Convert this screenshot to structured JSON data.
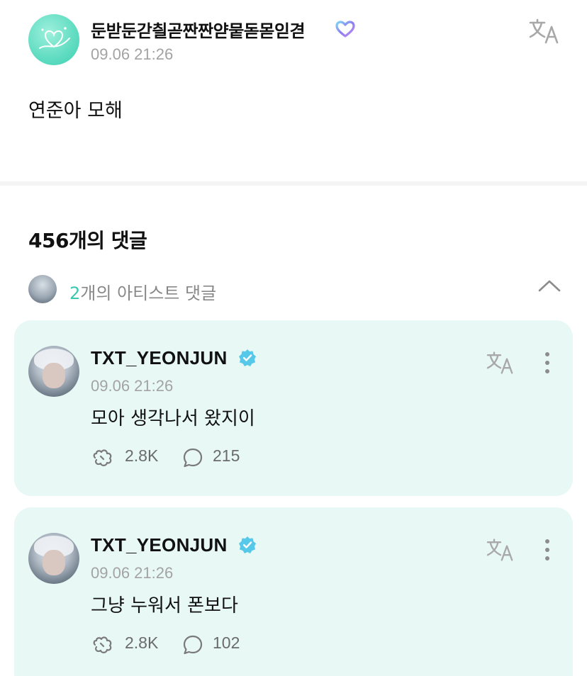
{
  "post": {
    "author": "둔받둔갇칄곧짠짠얃뭍돋몯읻겯",
    "timestamp": "09.06 21:26",
    "body": "연준아 모해",
    "avatar_color": "#5fdcc1"
  },
  "comments_section": {
    "title": "456개의 댓글",
    "artist_comments_count": "2",
    "artist_comments_label": "개의 아티스트 댓글"
  },
  "comments": [
    {
      "name": "TXT_YEONJUN",
      "timestamp": "09.06 21:26",
      "text": "모아 생각나서 왔지이",
      "likes": "2.8K",
      "replies": "215"
    },
    {
      "name": "TXT_YEONJUN",
      "timestamp": "09.06 21:26",
      "text": "그냥 누워서 폰보다",
      "likes": "2.8K",
      "replies": "102"
    }
  ],
  "colors": {
    "accent": "#3cc7b0",
    "card_bg": "#e8f8f5",
    "muted": "#a3a3a3"
  },
  "icons": [
    "translate-icon",
    "verified-badge-icon",
    "heart-badge-icon",
    "more-vertical-icon",
    "chevron-up-icon",
    "like-icon",
    "comment-icon"
  ]
}
